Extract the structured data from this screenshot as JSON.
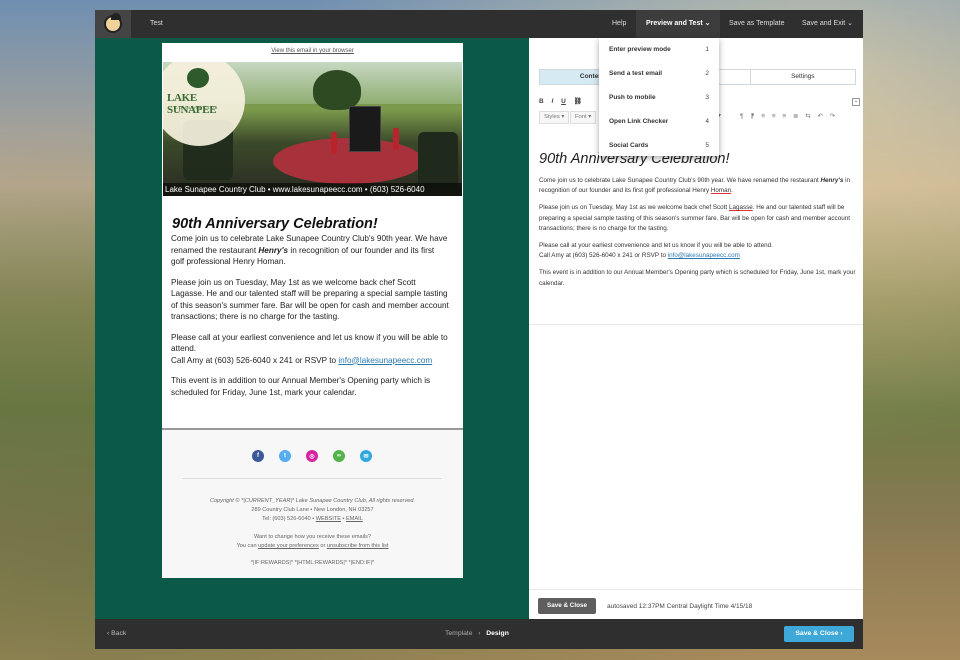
{
  "topbar": {
    "campaign_name": "Test",
    "help": "Help",
    "preview_and_test": "Preview and Test",
    "save_as_template": "Save as Template",
    "save_and_exit": "Save and Exit"
  },
  "preview_menu": {
    "items": [
      {
        "label": "Enter preview mode",
        "shortcut": "1"
      },
      {
        "label": "Send a test email",
        "shortcut": "2"
      },
      {
        "label": "Push to mobile",
        "shortcut": "3"
      },
      {
        "label": "Open Link Checker",
        "shortcut": "4"
      },
      {
        "label": "Social Cards",
        "shortcut": "5"
      }
    ]
  },
  "email_preview": {
    "view_in_browser": "View this email in your browser",
    "logo_name": "LAKE SUNAPEE",
    "logo_sub": "COUNTRY CLUB",
    "hero_caption": "Lake Sunapee Country Club  •  www.lakesunapeecc.com  •  (603) 526-6040",
    "heading": "90th Anniversary Celebration!",
    "p1_a": "Come join us to celebrate Lake Sunapee Country Club's 90th year.  We have renamed the restaurant ",
    "p1_b": "Henry's",
    "p1_c": " in recognition of our founder and its first golf professional Henry Homan.",
    "p2": "Please join us on Tuesday, May 1st as we welcome back chef Scott Lagasse.  He and our talented staff will be preparing a special sample tasting of this season's summer fare. Bar will be open for cash and member account transactions; there is no charge for the tasting.",
    "p3_a": "Please call at your earliest convenience and let us know if you will be able to attend.",
    "p3_b": "Call Amy at (603) 526-6040 x 241 or RSVP to ",
    "p3_link": "info@lakesunapeecc.com",
    "p4": "This event is in addition to our Annual Member's Opening party which is scheduled for Friday, June 1st, mark your calendar.",
    "footer": {
      "copyright": "Copyright © *|CURRENT_YEAR|* Lake Sunapee Country Club, All rights reserved.",
      "address": "289 Country Club Lane • New London, NH 03257",
      "tel_prefix": "Tel: (603) 526-6040 • ",
      "website": "WEBSITE",
      "sep": " • ",
      "email": "EMAIL",
      "change_q": "Want to change how you receive these emails?",
      "can_prefix": "You can ",
      "update_prefs": "update your preferences",
      "or": " or ",
      "unsubscribe": "unsubscribe from this list",
      "merge": "*|IF:REWARDS|* *|HTML:REWARDS|* *|END:IF|*"
    }
  },
  "editor": {
    "tabs": [
      "Content",
      "Style",
      "Settings"
    ],
    "format_buttons": [
      "B",
      "I",
      "U",
      "⛓"
    ],
    "styles_label": "Styles",
    "font_label": "Font",
    "tags_label": "ags",
    "heading": "90th Anniversary Celebration!",
    "p1_a": "Come join us to celebrate Lake Sunapee Country Club's 90th year.  We have renamed the restaurant ",
    "p1_b": "Henry's",
    "p1_c": " in recognition of our founder and its first golf professional Henry ",
    "p1_d": "Homan",
    "p1_e": ".",
    "p2_a": "Please join us on Tuesday, May 1st as we welcome back chef Scott ",
    "p2_b": "Lagasse",
    "p2_c": ".  He and our talented staff will be preparing a special sample tasting of this season's summer fare. Bar will be open for cash and member account transactions; there is no charge for the tasting.",
    "p3_a": "Please call at your earliest convenience and let us know if you will be able to attend.",
    "p3_b": "Call Amy at (603) 526-6040 x 241 or RSVP to ",
    "p3_link": "info@lakesunapeecc.com",
    "p4": "This event is in addition to our Annual Member's Opening party which is scheduled for Friday, June 1st, mark your calendar.",
    "save_close": "Save & Close",
    "autosaved": "autosaved 12:37PM Central Daylight Time 4/15/18"
  },
  "bottombar": {
    "back": "‹ Back",
    "crumb_template": "Template",
    "crumb_sep": "›",
    "crumb_design": "Design",
    "save_close": "Save & Close  ›"
  },
  "colors": {
    "app_green": "#0b5a48",
    "accent_blue": "#3ea8d8",
    "topbar": "#2f2f2f"
  }
}
